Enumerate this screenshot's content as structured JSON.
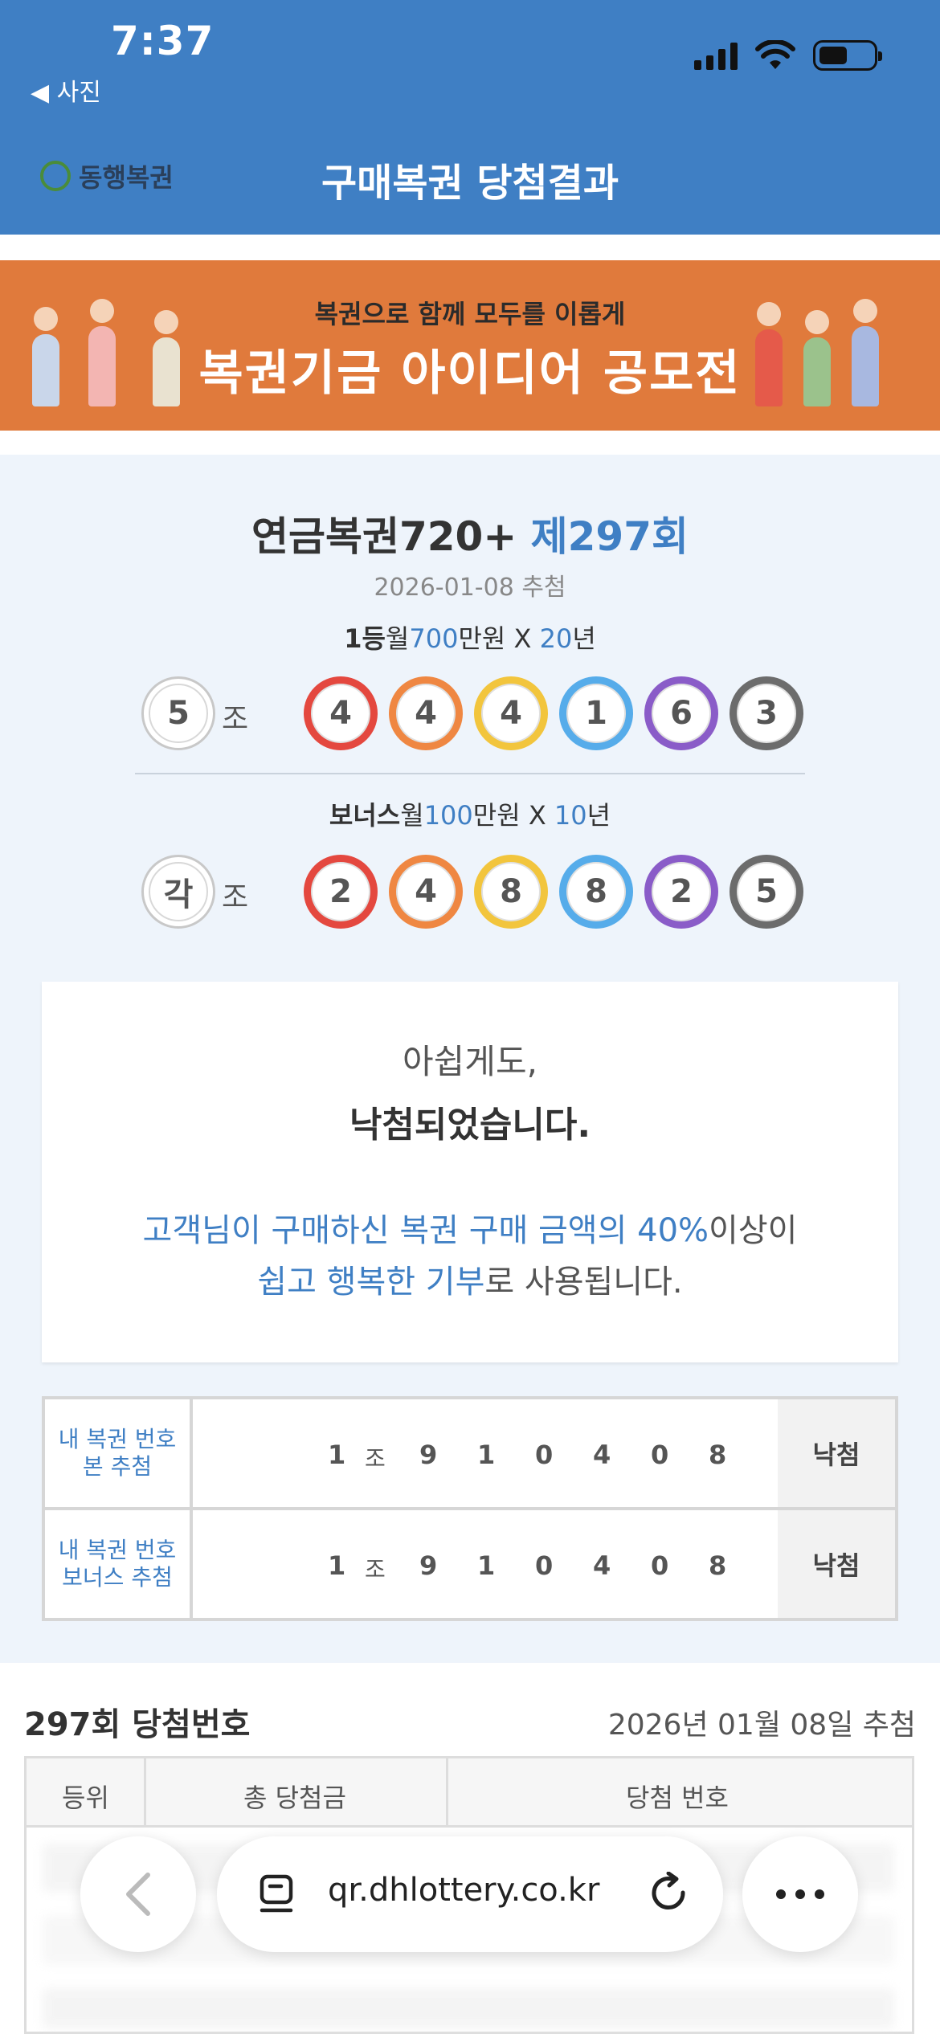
{
  "status_bar": {
    "time": "7:37",
    "back_label": "◀ 사진"
  },
  "header": {
    "brand": "동행복권",
    "title": "구매복권 당첨결과"
  },
  "banner": {
    "subtitle": "복권으로 함께 모두를 이롭게",
    "title": "복권기금 아이디어 공모전"
  },
  "result": {
    "lottery_name": "연금복권720+ ",
    "round": "제297회",
    "draw_date": "2026-01-08 추첨",
    "first_prize": {
      "rank": "1등",
      "w1": "월",
      "amount": "700",
      "w2": "만원 X ",
      "years": "20",
      "w3": "년"
    },
    "first_group": "5",
    "jo_label": "조",
    "first_numbers": [
      "4",
      "4",
      "4",
      "1",
      "6",
      "3"
    ],
    "bonus_prize": {
      "rank": "보너스",
      "w1": "월",
      "amount": "100",
      "w2": "만원 X ",
      "years": "10",
      "w3": "년"
    },
    "bonus_group": "각",
    "bonus_numbers": [
      "2",
      "4",
      "8",
      "8",
      "2",
      "5"
    ],
    "ball_colors": [
      "#e4483f",
      "#ef8742",
      "#f2c53d",
      "#56acea",
      "#8a5cc8",
      "#6c6c6c"
    ]
  },
  "message": {
    "line1": "아쉽게도,",
    "line2": "낙첨되었습니다.",
    "line3_blue": "고객님이 구매하신 복권 구매 금액의 40%",
    "line3_rest": "이상이",
    "line4_blue": "쉽고 행복한 기부",
    "line4_rest": "로 사용됩니다."
  },
  "my_tickets": [
    {
      "label1": "내 복권 번호",
      "label2": "본 추첨",
      "group": "1",
      "jo": "조",
      "numbers": [
        "9",
        "1",
        "0",
        "4",
        "0",
        "8"
      ],
      "status": "낙첨"
    },
    {
      "label1": "내 복권 번호",
      "label2": "보너스 추첨",
      "group": "1",
      "jo": "조",
      "numbers": [
        "9",
        "1",
        "0",
        "4",
        "0",
        "8"
      ],
      "status": "낙첨"
    }
  ],
  "winning_section": {
    "title": "297회 당첨번호",
    "date": "2026년 01월 08일 추첨",
    "columns": [
      "등위",
      "총 당첨금",
      "당첨 번호"
    ]
  },
  "browser": {
    "url": "qr.dhlottery.co.kr"
  }
}
